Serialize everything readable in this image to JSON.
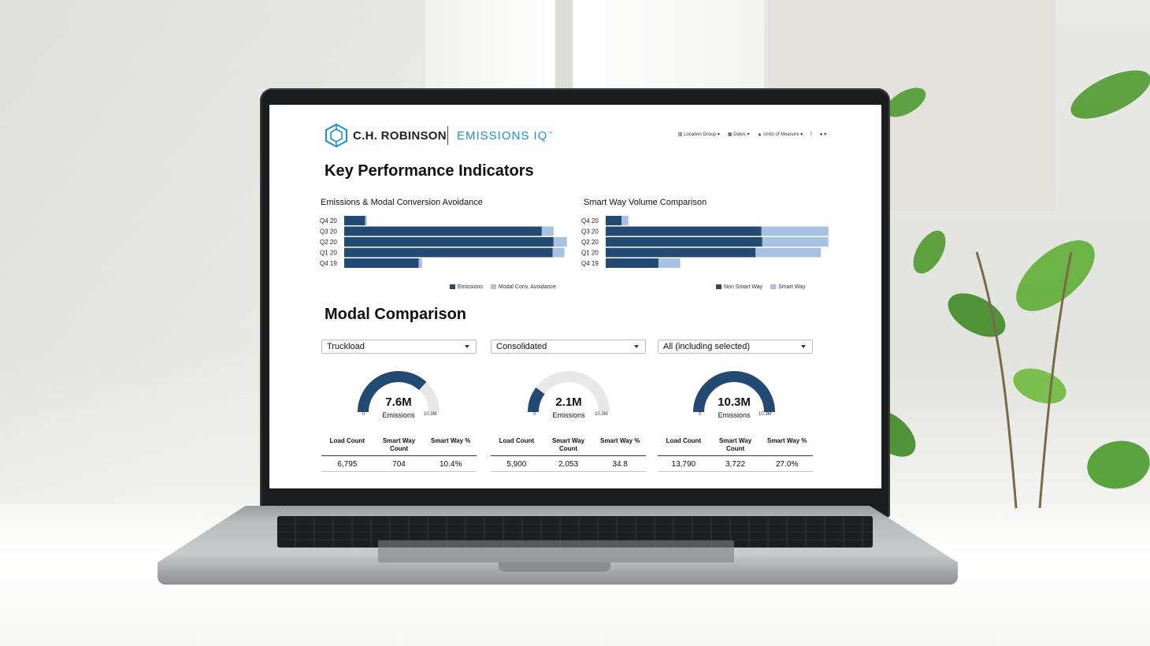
{
  "header": {
    "brand": "C.H. ROBINSON",
    "product": "EMISSIONS IQ",
    "product_tm": "™",
    "nav": [
      {
        "icon": "building-icon",
        "label": "Location Group ▾"
      },
      {
        "icon": "calendar-icon",
        "label": "Dates ▾"
      },
      {
        "icon": "scale-icon",
        "label": "Units of Measure ▾"
      },
      {
        "icon": "user-icon",
        "label": "▾"
      }
    ]
  },
  "kpi_section": {
    "title": "Key Performance Indicators"
  },
  "modal_section": {
    "title": "Modal Comparison"
  },
  "colors": {
    "dark": "#234a72",
    "light": "#a6c2e0",
    "brand_blue": "#1a8fd1",
    "gauge_bg": "#e8e8e8"
  },
  "chart_data": [
    {
      "type": "bar",
      "orientation": "horizontal",
      "stacked": true,
      "title": "Emissions & Modal Conversion Avoidance",
      "categories": [
        "Q4 20",
        "Q3 20",
        "Q2 20",
        "Q1 20",
        "Q4 19"
      ],
      "series": [
        {
          "name": "Emissions",
          "values": [
            25,
            236,
            250,
            249,
            89
          ]
        },
        {
          "name": "Modal Conv. Avoidance",
          "values": [
            2,
            14,
            16,
            14,
            4
          ]
        }
      ],
      "xlim": [
        0,
        270
      ],
      "legend": "bottom-right"
    },
    {
      "type": "bar",
      "orientation": "horizontal",
      "stacked": true,
      "title": "Smart Way Volume Comparison",
      "categories": [
        "Q4 20",
        "Q3 20",
        "Q2 20",
        "Q1 20",
        "Q4 19"
      ],
      "series": [
        {
          "name": "Non Smart Way",
          "values": [
            19,
            186,
            187,
            179,
            63
          ]
        },
        {
          "name": "Smart Way",
          "values": [
            8,
            80,
            79,
            78,
            26
          ]
        }
      ],
      "xlim": [
        0,
        270
      ],
      "legend": "bottom-right"
    }
  ],
  "modal_panels": [
    {
      "select": "Truckload",
      "value": "7.6M",
      "label": "Emissions",
      "min": "0",
      "max": "10.3M",
      "fraction": 0.738,
      "cols": [
        "Load Count",
        "Smart Way Count",
        "Smart Way %"
      ],
      "row": [
        "6,795",
        "704",
        "10.4%"
      ]
    },
    {
      "select": "Consolidated",
      "value": "2.1M",
      "label": "Emissions",
      "min": "0",
      "max": "10.3M",
      "fraction": 0.204,
      "cols": [
        "Load Count",
        "Smart Way Count",
        "Smart Way %"
      ],
      "row": [
        "5,900",
        "2,053",
        "34.8"
      ]
    },
    {
      "select": "All (including selected)",
      "value": "10.3M",
      "label": "Emissions",
      "min": "0",
      "max": "10.3M",
      "fraction": 1.0,
      "cols": [
        "Load Count",
        "Smart Way Count",
        "Smart Way %"
      ],
      "row": [
        "13,790",
        "3,722",
        "27.0%"
      ]
    }
  ]
}
